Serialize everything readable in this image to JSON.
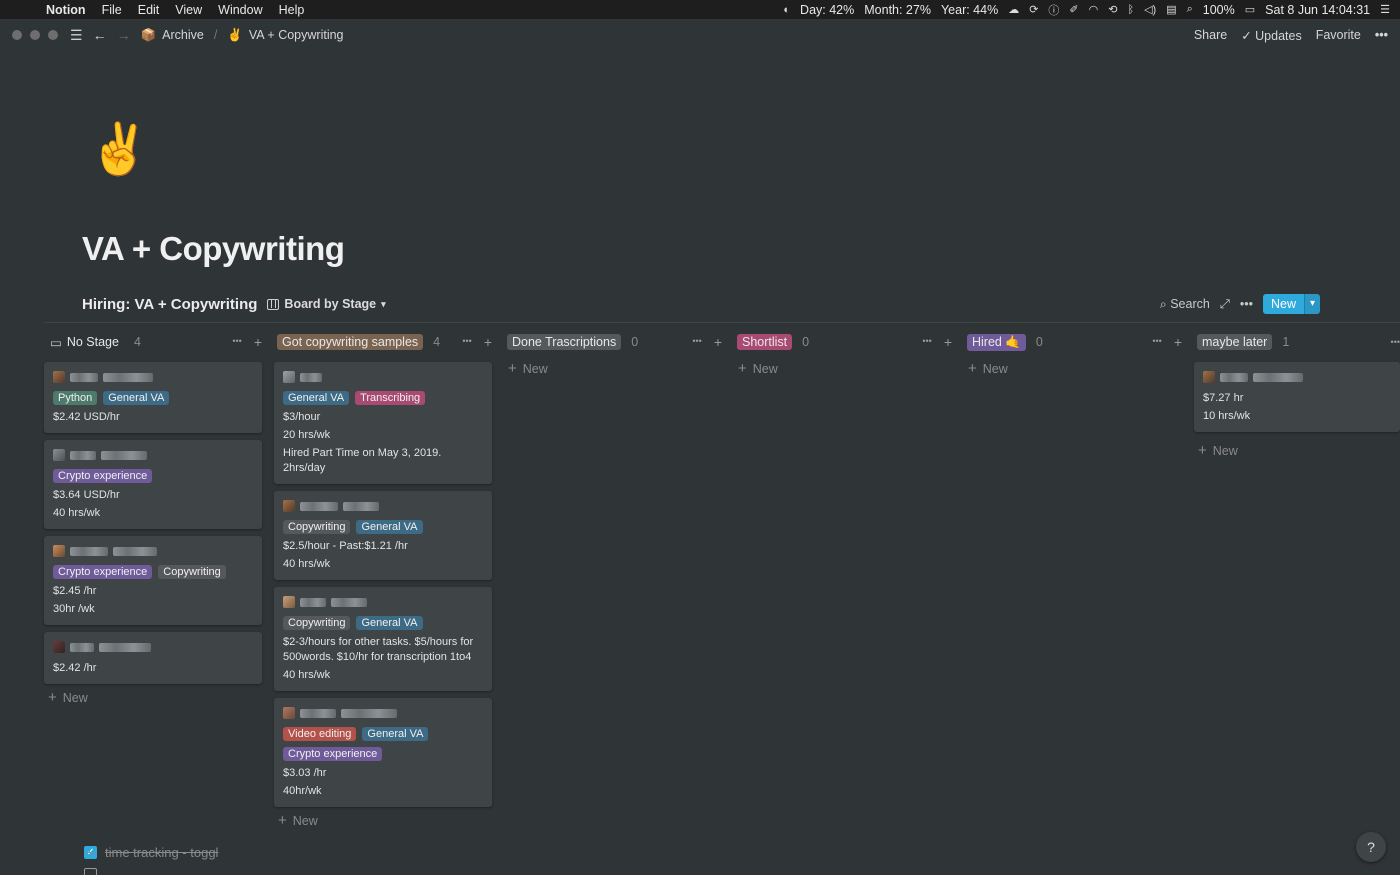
{
  "menubar": {
    "app": "Notion",
    "items": [
      "File",
      "Edit",
      "View",
      "Window",
      "Help"
    ],
    "status": {
      "day": "Day: 42%",
      "month": "Month: 27%",
      "year": "Year: 44%",
      "battery": "100%",
      "datetime": "Sat 8 Jun  14:04:31"
    }
  },
  "topbar": {
    "breadcrumb": [
      {
        "icon": "📦",
        "label": "Archive"
      },
      {
        "icon": "✌️",
        "label": "VA + Copywriting"
      }
    ],
    "share": "Share",
    "updates": "Updates",
    "favorite": "Favorite"
  },
  "page": {
    "icon": "✌️",
    "title": "VA + Copywriting"
  },
  "database": {
    "title": "Hiring: VA + Copywriting",
    "view": "Board by Stage",
    "search": "Search",
    "new_button": "New"
  },
  "board": {
    "new_label": "New",
    "columns": [
      {
        "name": "No Stage",
        "count": "4",
        "color": "",
        "cards": [
          {
            "tags": [
              {
                "label": "Python",
                "color": "#4d7a6a"
              },
              {
                "label": "General VA",
                "color": "#3d6a85"
              }
            ],
            "lines": [
              "$2.42 USD/hr"
            ]
          },
          {
            "tags": [
              {
                "label": "Crypto experience",
                "color": "#6f5b99"
              }
            ],
            "lines": [
              "$3.64 USD/hr",
              "40 hrs/wk"
            ]
          },
          {
            "tags": [
              {
                "label": "Crypto experience",
                "color": "#6f5b99"
              },
              {
                "label": "Copywriting",
                "color": "#55595c"
              }
            ],
            "lines": [
              "$2.45 /hr",
              "30hr /wk"
            ]
          },
          {
            "tags": [],
            "lines": [
              "$2.42 /hr"
            ]
          }
        ]
      },
      {
        "name": "Got copywriting samples",
        "count": "4",
        "color": "#7a6451",
        "cards": [
          {
            "tags": [
              {
                "label": "General VA",
                "color": "#3d6a85"
              },
              {
                "label": "Transcribing",
                "color": "#a84a72"
              }
            ],
            "lines": [
              "$3/hour",
              "20 hrs/wk",
              "Hired Part Time on May 3, 2019. 2hrs/day"
            ]
          },
          {
            "tags": [
              {
                "label": "Copywriting",
                "color": "#55595c"
              },
              {
                "label": "General VA",
                "color": "#3d6a85"
              }
            ],
            "lines": [
              "$2.5/hour - Past:$1.21 /hr",
              "40 hrs/wk"
            ]
          },
          {
            "tags": [
              {
                "label": "Copywriting",
                "color": "#55595c"
              },
              {
                "label": "General VA",
                "color": "#3d6a85"
              }
            ],
            "lines": [
              "$2-3/hours for other tasks. $5/hours for 500words. $10/hr for transcription 1to4",
              "40 hrs/wk"
            ]
          },
          {
            "tags": [
              {
                "label": "Video editing",
                "color": "#b3524a"
              },
              {
                "label": "General VA",
                "color": "#3d6a85"
              },
              {
                "label": "Crypto experience",
                "color": "#6f5b99"
              }
            ],
            "lines": [
              "$3.03 /hr",
              "40hr/wk"
            ]
          }
        ]
      },
      {
        "name": "Done Trascriptions",
        "count": "0",
        "color": "#55595c",
        "cards": []
      },
      {
        "name": "Shortlist",
        "count": "0",
        "color": "#a84a72",
        "cards": []
      },
      {
        "name": "Hired 🤙",
        "count": "0",
        "color": "#6f5b99",
        "cards": []
      },
      {
        "name": "maybe later",
        "count": "1",
        "color": "#55595c",
        "cards": [
          {
            "tags": [],
            "lines": [
              "$7.27 hr",
              "10 hrs/wk"
            ]
          }
        ]
      }
    ]
  },
  "todos": [
    {
      "label": "time tracking - toggl",
      "checked": true
    }
  ],
  "help": "?"
}
